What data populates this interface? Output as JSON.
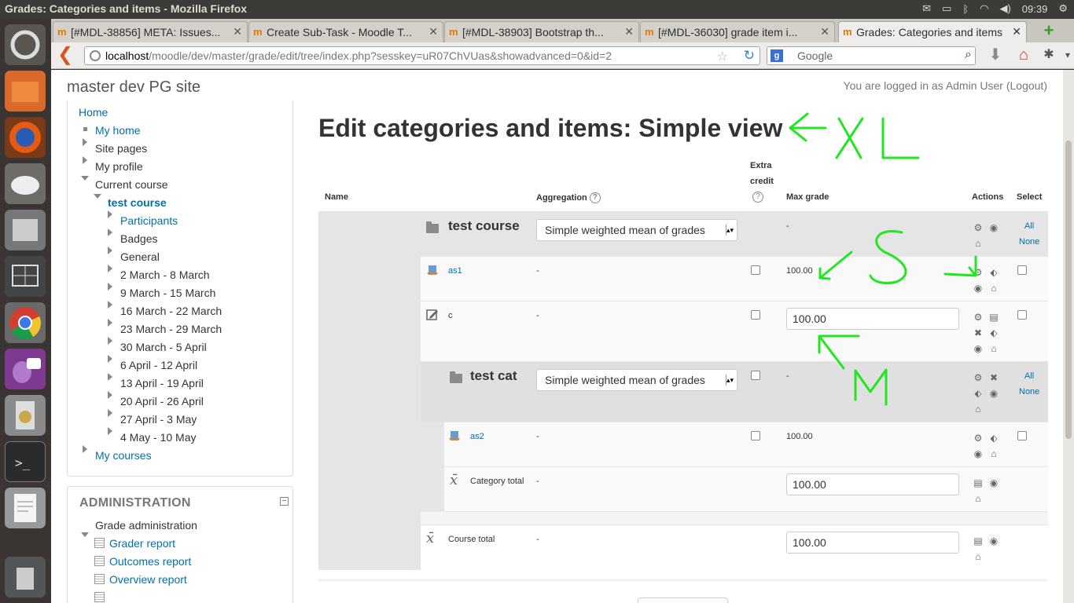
{
  "window": {
    "title": "Grades: Categories and items - Mozilla Firefox",
    "clock": "09:39"
  },
  "tabs": [
    {
      "label": "[#MDL-38856] META: Issues..."
    },
    {
      "label": "Create Sub-Task - Moodle T..."
    },
    {
      "label": "[#MDL-38903] Bootstrap th..."
    },
    {
      "label": "[#MDL-36030] grade item i..."
    },
    {
      "label": "Grades: Categories and items",
      "active": true
    }
  ],
  "navbar": {
    "url_host": "localhost",
    "url_path": "/moodle/dev/master/grade/edit/tree/index.php?sesskey=uR07ChVUas&showadvanced=0&id=2",
    "search_placeholder": "Google"
  },
  "site": {
    "name": "master dev PG site",
    "login_prefix": "You are logged in as ",
    "login_user": "Admin User",
    "logout": "(Logout)"
  },
  "navigation": {
    "home": "Home",
    "my_home": "My home",
    "site_pages": "Site pages",
    "my_profile": "My profile",
    "current_course": "Current course",
    "course": "test course",
    "participants": "Participants",
    "badges": "Badges",
    "general": "General",
    "weeks": [
      "2 March - 8 March",
      "9 March - 15 March",
      "16 March - 22 March",
      "23 March - 29 March",
      "30 March - 5 April",
      "6 April - 12 April",
      "13 April - 19 April",
      "20 April - 26 April",
      "27 April - 3 May",
      "4 May - 10 May"
    ],
    "my_courses": "My courses"
  },
  "administration": {
    "heading": "ADMINISTRATION",
    "grade_admin": "Grade administration",
    "reports": [
      "Grader report",
      "Outcomes report",
      "Overview report"
    ]
  },
  "main": {
    "heading": "Edit categories and items: Simple view",
    "columns": {
      "name": "Name",
      "aggregation": "Aggregation",
      "extra_credit_1": "Extra",
      "extra_credit_2": "credit",
      "max_grade": "Max grade",
      "actions": "Actions",
      "select": "Select"
    },
    "help_glyph": "?",
    "select_all": "All",
    "select_none": "None",
    "rows": {
      "course_cat": {
        "name": "test course",
        "aggregation": "Simple weighted mean of grades",
        "max": "-"
      },
      "as1": {
        "name": "as1",
        "agg": "-",
        "max": "100.00"
      },
      "c": {
        "name": "c",
        "agg": "-",
        "max": "100.00"
      },
      "test_cat": {
        "name": "test cat",
        "aggregation": "Simple weighted mean of grades",
        "max": "-"
      },
      "as2": {
        "name": "as2",
        "agg": "-",
        "max": "100.00"
      },
      "cat_total": {
        "name": "Category total",
        "agg": "-",
        "max": "100.00"
      },
      "course_total": {
        "name": "Course total",
        "agg": "-",
        "max": "100.00"
      }
    }
  },
  "annotations": {
    "xl": "XL",
    "s": "S",
    "m": "M",
    "color": "#22e622"
  },
  "colors": {
    "link": "#0070a8",
    "category_row": "#e5e5e5"
  }
}
